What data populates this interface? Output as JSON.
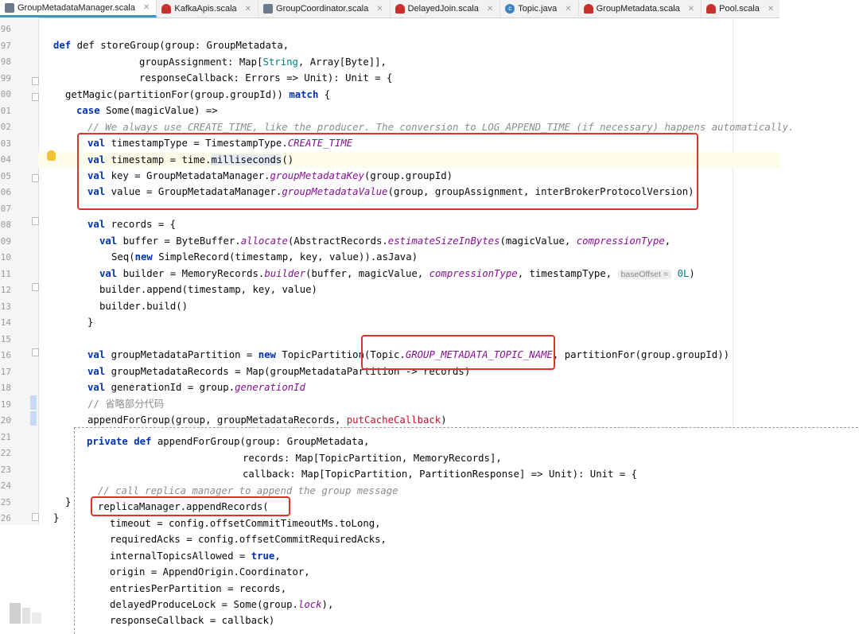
{
  "tabs": [
    {
      "label": "GroupMetadataManager.scala",
      "icon": "scala-object-icon",
      "active": true
    },
    {
      "label": "KafkaApis.scala",
      "icon": "scala-class-icon"
    },
    {
      "label": "GroupCoordinator.scala",
      "icon": "scala-object-icon"
    },
    {
      "label": "DelayedJoin.scala",
      "icon": "scala-file-icon"
    },
    {
      "label": "Topic.java",
      "icon": "java-class-icon"
    },
    {
      "label": "GroupMetadata.scala",
      "icon": "scala-file-icon"
    },
    {
      "label": "Pool.scala",
      "icon": "scala-class-icon"
    }
  ],
  "line_numbers": [
    "96",
    "97",
    "98",
    "99",
    "00",
    "01",
    "02",
    "03",
    "04",
    "05",
    "06",
    "07",
    "08",
    "09",
    "10",
    "11",
    "12",
    "13",
    "14",
    "15",
    "16",
    "17",
    "18",
    "19",
    "20",
    "21",
    "22",
    "23",
    "24",
    "25",
    "26"
  ],
  "code": {
    "l0": "def storeGroup(group: GroupMetadata,",
    "l1": "groupAssignment: Map[",
    "l1t": "String",
    "l1b": ", Array[Byte]],",
    "l2": "responseCallback: Errors => Unit): Unit = {",
    "l3a": "getMagic(partitionFor(group.groupId)) ",
    "l3k": "match",
    "l3b": " {",
    "l4k": "case",
    "l4": " Some(magicValue) =>",
    "l5": "// We always use CREATE_TIME, like the producer. The conversion to LOG_APPEND_TIME (if necessary) happens automatically.",
    "l6a": "timestampType = TimestampType.",
    "l6i": "CREATE_TIME",
    "l7a": "timestamp = time.",
    "l7h": "milliseconds",
    "l7b": "()",
    "l8a": "key = GroupMetadataManager.",
    "l8i": "groupMetadataKey",
    "l8b": "(group.groupId)",
    "l9a": "value = GroupMetadataManager.",
    "l9i": "groupMetadataValue",
    "l9b": "(group, groupAssignment, interBrokerProtocolVersion)",
    "l11": "records = {",
    "l12a": "buffer = ByteBuffer.",
    "l12i": "allocate",
    "l12b": "(AbstractRecords.",
    "l12i2": "estimateSizeInBytes",
    "l12c": "(magicValue, ",
    "l12i3": "compressionType",
    "l12d": ",",
    "l13a": "Seq(",
    "l13b": " SimpleRecord(timestamp, key, value)).asJava)",
    "l14a": "builder = MemoryRecords.",
    "l14i": "builder",
    "l14b": "(buffer, magicValue, ",
    "l14i2": "compressionType",
    "l14c": ", timestampType, ",
    "l14h": "baseOffset =",
    "l14n": "0L",
    "l14d": ")",
    "l15": "builder.append(timestamp, key, value)",
    "l16": "builder.build()",
    "l17": "}",
    "l19a": "groupMetadataPartition = ",
    "l19b": " TopicPartition(",
    "l19c": "Topic.",
    "l19i": "GROUP_METADATA_TOPIC_NAME",
    "l19d": ", partitionFor(group.groupId))",
    "l20": "groupMetadataRecords = Map(groupMetadataPartition -> records)",
    "l21a": "generationId = group.",
    "l21i": "generationId",
    "l22": "// 省略部分代码",
    "l23a": "appendForGroup(group, groupMetadataRecords, ",
    "l23r": "putCacheCallback",
    "l23b": ")",
    "l28": "}",
    "l29": "}"
  },
  "keywords": {
    "def": "def",
    "val": "val",
    "new": "new",
    "private": "private",
    "true": "true"
  },
  "overlay": {
    "o0a": "appendForGroup(group: GroupMetadata,",
    "o1": "records: Map[TopicPartition, MemoryRecords],",
    "o2": "callback: Map[TopicPartition, PartitionResponse] => Unit): Unit = {",
    "o3": "// call replica manager to append the group message",
    "o4": "replicaManager.appendRecords(",
    "o5": "timeout = config.offsetCommitTimeoutMs.toLong,",
    "o6": "requiredAcks = config.offsetCommitRequiredAcks,",
    "o7a": "internalTopicsAllowed = ",
    "o7b": ",",
    "o8": "origin = AppendOrigin.Coordinator,",
    "o9": "entriesPerPartition = records,",
    "o10a": "delayedProduceLock = Some(group.",
    "o10i": "lock",
    "o10b": "),",
    "o11": "responseCallback = callback)"
  },
  "colors": {
    "annotation_box": "#e0322b",
    "keyword": "#0033b3",
    "italic_member": "#871094",
    "comment": "#8c8c8c"
  }
}
